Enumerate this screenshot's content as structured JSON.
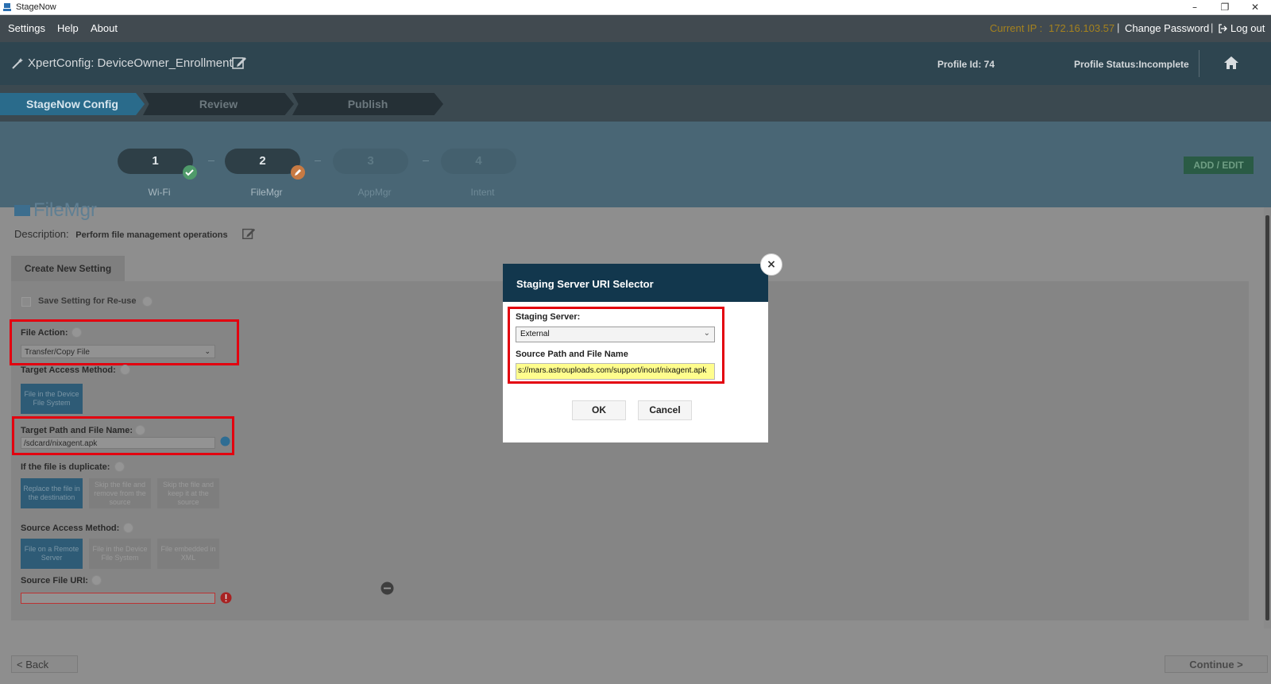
{
  "window": {
    "title": "StageNow",
    "controls": [
      "–",
      "❐",
      "✕"
    ]
  },
  "menu": {
    "items": [
      "Settings",
      "Help",
      "About"
    ],
    "ip_label": "Current IP :",
    "ip_value": "172.16.103.57",
    "change_password": "Change Password",
    "logout": "Log out"
  },
  "header": {
    "profile_title": "XpertConfig: DeviceOwner_Enrollment",
    "profile_id": "Profile Id: 74",
    "profile_status": "Profile Status:Incomplete"
  },
  "breadcrumb": [
    "StageNow Config",
    "Review",
    "Publish"
  ],
  "steps": [
    {
      "num": "1",
      "label": "Wi-Fi",
      "state": "done"
    },
    {
      "num": "2",
      "label": "FileMgr",
      "state": "editing"
    },
    {
      "num": "3",
      "label": "AppMgr",
      "state": "pending"
    },
    {
      "num": "4",
      "label": "Intent",
      "state": "pending"
    }
  ],
  "add_edit": "ADD / EDIT",
  "module": {
    "title": "FileMgr",
    "desc_label": "Description:",
    "desc_value": "Perform file management operations"
  },
  "form": {
    "tab": "Create New Setting",
    "save_setting": "Save Setting for Re-use",
    "file_action_label": "File Action:",
    "file_action_value": "Transfer/Copy File",
    "target_access_label": "Target Access Method:",
    "target_access_options": [
      "File in the Device File System"
    ],
    "target_path_label": "Target Path and File Name:",
    "target_path_value": "/sdcard/nixagent.apk",
    "duplicate_label": "If the file is duplicate:",
    "duplicate_options": [
      "Replace the file in the destination",
      "Skip the file and remove from the source",
      "Skip the file and keep it at the source"
    ],
    "source_access_label": "Source Access Method:",
    "source_access_options": [
      "File on a Remote Server",
      "File in the Device File System",
      "File embedded in XML"
    ],
    "source_uri_label": "Source File URI:",
    "source_uri_value": ""
  },
  "nav": {
    "back": "<  Back",
    "continue": "Continue  >"
  },
  "modal": {
    "title": "Staging Server URI Selector",
    "server_label": "Staging Server:",
    "server_value": "External",
    "path_label": "Source Path and File Name",
    "path_value": "s://mars.astrouploads.com/support/inout/nixagent.apk",
    "ok": "OK",
    "cancel": "Cancel",
    "close": "×"
  },
  "colors": {
    "accent": "#12374d",
    "highlight_border": "#e3000f",
    "input_highlight": "#fffd8d"
  }
}
